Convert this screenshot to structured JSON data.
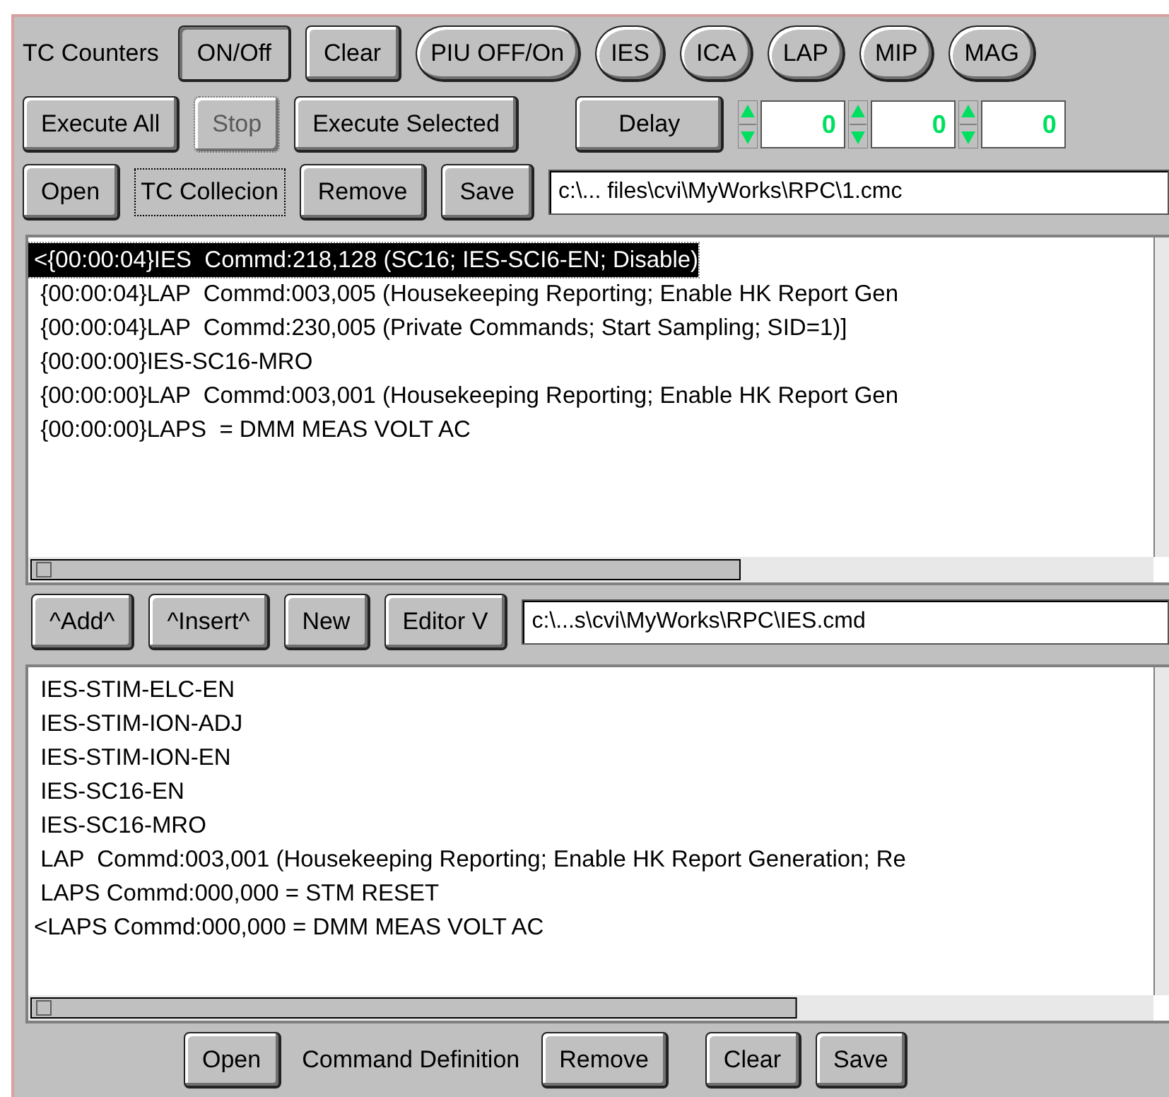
{
  "counters_row": {
    "label": "TC Counters",
    "buttons": [
      {
        "label": "ON/Off",
        "kind": "toggle",
        "pressed": true
      },
      {
        "label": "Clear",
        "kind": "button",
        "pressed": false
      },
      {
        "label": "PIU OFF/On",
        "kind": "pill",
        "pressed": false
      },
      {
        "label": "IES",
        "kind": "pill",
        "pressed": false
      },
      {
        "label": "ICA",
        "kind": "pill",
        "pressed": false
      },
      {
        "label": "LAP",
        "kind": "pill",
        "pressed": false
      },
      {
        "label": "MIP",
        "kind": "pill",
        "pressed": false
      },
      {
        "label": "MAG",
        "kind": "pill",
        "pressed": false
      }
    ]
  },
  "execute_row": {
    "buttons": [
      {
        "label": "Execute All",
        "disabled": false
      },
      {
        "label": "Stop",
        "disabled": true
      },
      {
        "label": "Execute Selected",
        "disabled": false
      }
    ],
    "delay_button": "Delay",
    "delay_values": [
      "0",
      "0",
      "0"
    ]
  },
  "collection_row": {
    "buttons": [
      {
        "label": "Open",
        "kind": "button"
      },
      {
        "label": "TC Collecion",
        "kind": "label"
      },
      {
        "label": "Remove",
        "kind": "button"
      },
      {
        "label": "Save",
        "kind": "button"
      }
    ],
    "path": "c:\\... files\\cvi\\MyWorks\\RPC\\1.cmc"
  },
  "collection_list": [
    {
      "text": "<{00:00:04}IES  Commd:218,128 (SC16; IES-SCI6-EN; Disable)",
      "selected": true
    },
    {
      "text": " {00:00:04}LAP  Commd:003,005 (Housekeeping Reporting; Enable HK Report Gen",
      "selected": false
    },
    {
      "text": " {00:00:04}LAP  Commd:230,005 (Private Commands; Start Sampling; SID=1)]",
      "selected": false
    },
    {
      "text": " {00:00:00}IES-SC16-MRO",
      "selected": false
    },
    {
      "text": " {00:00:00}LAP  Commd:003,001 (Housekeeping Reporting; Enable HK Report Gen",
      "selected": false
    },
    {
      "text": " {00:00:00}LAPS  = DMM MEAS VOLT AC",
      "selected": false
    }
  ],
  "editor_row": {
    "buttons": [
      "^Add^",
      "^Insert^",
      "New",
      "Editor V"
    ],
    "path": "c:\\...s\\cvi\\MyWorks\\RPC\\IES.cmd"
  },
  "command_list": [
    " IES-STIM-ELC-EN",
    " IES-STIM-ION-ADJ",
    " IES-STIM-ION-EN",
    " IES-SC16-EN",
    " IES-SC16-MRO",
    " LAP  Commd:003,001 (Housekeeping Reporting; Enable HK Report Generation; Re",
    " LAPS Commd:000,000 = STM RESET",
    "<LAPS Commd:000,000 = DMM MEAS VOLT AC"
  ],
  "bottom_row": [
    {
      "label": "Open",
      "kind": "button"
    },
    {
      "label": "Command Definition",
      "kind": "label"
    },
    {
      "label": "Remove",
      "kind": "button"
    },
    {
      "label": "Clear",
      "kind": "button"
    },
    {
      "label": "Save",
      "kind": "button"
    }
  ]
}
